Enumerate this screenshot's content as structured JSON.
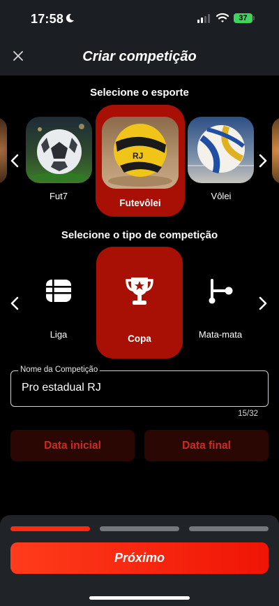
{
  "status_bar": {
    "time": "17:58",
    "battery": "37"
  },
  "header": {
    "title": "Criar competição"
  },
  "sport_section": {
    "title": "Selecione o esporte",
    "items": [
      {
        "label": "Fut7",
        "icon": "soccer-ball-image",
        "selected": false
      },
      {
        "label": "Futevôlei",
        "icon": "footvolley-ball-image",
        "selected": true
      },
      {
        "label": "Vôlei",
        "icon": "volleyball-image",
        "selected": false
      }
    ]
  },
  "type_section": {
    "title": "Selecione o tipo de competição",
    "items": [
      {
        "label": "Liga",
        "icon": "list-icon",
        "selected": false
      },
      {
        "label": "Copa",
        "icon": "trophy-icon",
        "selected": true
      },
      {
        "label": "Mata-mata",
        "icon": "bracket-icon",
        "selected": false
      }
    ]
  },
  "form": {
    "name_label": "Nome da Competição",
    "name_value": "Pro estadual RJ",
    "counter": "15/32",
    "start_date_label": "Data inicial",
    "end_date_label": "Data final"
  },
  "footer": {
    "steps": [
      {
        "active": true
      },
      {
        "active": false
      },
      {
        "active": false
      }
    ],
    "next_label": "Próximo"
  },
  "colors": {
    "accent": "#a81006",
    "button": "#ff2a10",
    "background": "#000000",
    "header": "#1b1e22"
  }
}
